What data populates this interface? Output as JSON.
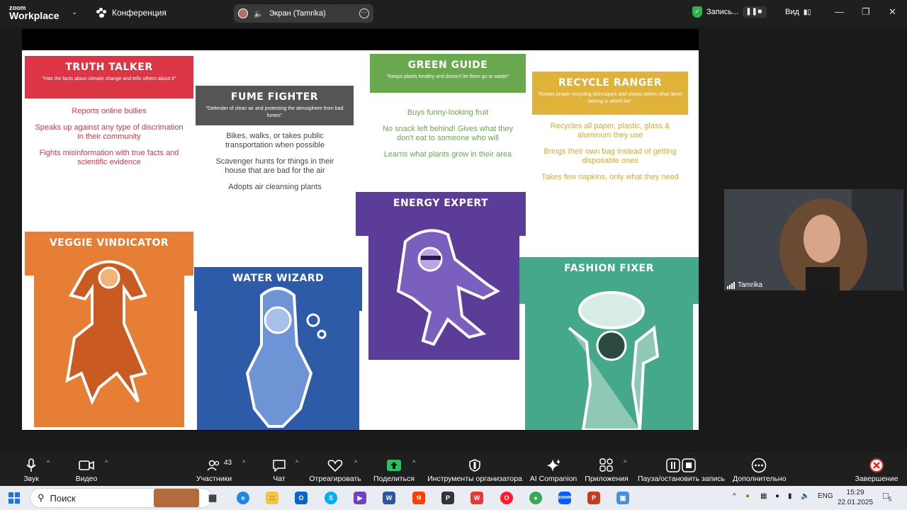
{
  "topbar": {
    "logo_small": "zoom",
    "logo_big": "Workplace",
    "meeting_label": "Конференция",
    "screen_share_label": "Экран (Tamrika)",
    "recording_label": "Запись...",
    "view_label": "Вид"
  },
  "slide": {
    "cards": [
      {
        "title": "TRUTH TALKER",
        "subtitle": "\"Has the facts about climate change and tells others about it\"",
        "color": "#dc3545",
        "bullets": [
          "Reports online bullies",
          "Speaks up against any type of discrimation in their community",
          "Fights misinformation with true facts and scientific evidence"
        ]
      },
      {
        "title": "FUME FIGHTER",
        "subtitle": "\"Defender of clean air and protecting the atmosphere from bad fumes\"",
        "color": "#555558",
        "bullets": [
          "Bikes, walks, or takes public transportation when possible",
          "Scavenger hunts for things in their house that are bad for the air",
          "Adopts air cleansing plants"
        ]
      },
      {
        "title": "GREEN GUIDE",
        "subtitle": "\"Keeps plants healthy and doesn't let them go to waste\"",
        "color": "#6aa84f",
        "bullets": [
          "Buys funny-looking fruit",
          "No snack left behind! Gives what they don't eat to someone who will",
          "Learns what plants grow in their area"
        ]
      },
      {
        "title": "RECYCLE RANGER",
        "subtitle": "\"Knows proper recycling techniques and shows others what items belong in which bin\"",
        "color": "#e0b23a",
        "bullets": [
          "Recycles all paper, plastic, glass & aluminum they use",
          "Brings their own bag instead of getting disposable ones",
          "Takes few napkins, only what they need"
        ]
      }
    ],
    "heroes": [
      {
        "title": "VEGGIE VINDICATOR",
        "color": "#e67e35"
      },
      {
        "title": "WATER WIZARD",
        "color": "#2e5ba8"
      },
      {
        "title": "ENERGY EXPERT",
        "color": "#5b3d99"
      },
      {
        "title": "FASHION FIXER",
        "color": "#45a88a"
      }
    ]
  },
  "participant": {
    "name": "Tamrika"
  },
  "toolbar": {
    "audio": "Звук",
    "video": "Видео",
    "participants": "Участники",
    "participants_count": "43",
    "chat": "Чат",
    "react": "Отреагировать",
    "share": "Поделиться",
    "host_tools": "Инструменты организатора",
    "ai": "AI Companion",
    "apps": "Приложения",
    "pause_record": "Пауза/остановить запись",
    "more": "Дополнительно",
    "end": "Завершение"
  },
  "taskbar": {
    "search_placeholder": "Поиск",
    "lang": "ENG",
    "time": "15:29",
    "date": "22.01.2025",
    "notif_count": "5"
  }
}
